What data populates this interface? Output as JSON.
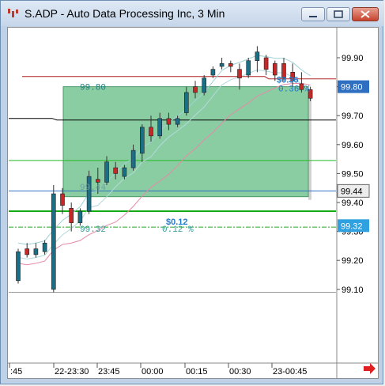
{
  "window": {
    "title": "S.ADP - Auto Data Processing Inc, 3 Min",
    "buttons": [
      "minimize",
      "restore",
      "close"
    ]
  },
  "chart_data": {
    "type": "candlestick",
    "symbol": "S.ADP",
    "interval": "3 Min",
    "ylim": [
      99.07,
      100.02
    ],
    "y_ticks": [
      "99.90",
      "99.80",
      "99.70",
      "99.60",
      "99.50",
      "99.40",
      "99.30",
      "99.20",
      "99.10"
    ],
    "x_ticks": [
      ":45",
      "22-23:30",
      "23:45",
      "00:00",
      "00:15",
      "00:30",
      "23-00:45"
    ],
    "price_markers": [
      {
        "label": "99.80",
        "value": 99.8,
        "fill": "#2f6fc2",
        "text": "#ffffff"
      },
      {
        "label": "99.44",
        "value": 99.44,
        "fill": "#ececec",
        "text": "#000000"
      },
      {
        "label": "99.32",
        "value": 99.32,
        "fill": "#2fa0e0",
        "text": "#ffffff"
      }
    ],
    "candles": [
      {
        "o": 99.13,
        "h": 99.24,
        "l": 99.12,
        "c": 99.23,
        "dir": "up"
      },
      {
        "o": 99.24,
        "h": 99.26,
        "l": 99.21,
        "c": 99.22,
        "dir": "down"
      },
      {
        "o": 99.22,
        "h": 99.26,
        "l": 99.21,
        "c": 99.24,
        "dir": "up"
      },
      {
        "o": 99.23,
        "h": 99.27,
        "l": 99.22,
        "c": 99.26,
        "dir": "up"
      },
      {
        "o": 99.1,
        "h": 99.46,
        "l": 99.09,
        "c": 99.43,
        "dir": "up"
      },
      {
        "o": 99.43,
        "h": 99.45,
        "l": 99.36,
        "c": 99.39,
        "dir": "down"
      },
      {
        "o": 99.38,
        "h": 99.4,
        "l": 99.3,
        "c": 99.33,
        "dir": "down"
      },
      {
        "o": 99.33,
        "h": 99.38,
        "l": 99.32,
        "c": 99.37,
        "dir": "up"
      },
      {
        "o": 99.37,
        "h": 99.51,
        "l": 99.36,
        "c": 99.49,
        "dir": "up"
      },
      {
        "o": 99.48,
        "h": 99.52,
        "l": 99.43,
        "c": 99.47,
        "dir": "down"
      },
      {
        "o": 99.47,
        "h": 99.56,
        "l": 99.46,
        "c": 99.54,
        "dir": "up"
      },
      {
        "o": 99.52,
        "h": 99.54,
        "l": 99.48,
        "c": 99.5,
        "dir": "down"
      },
      {
        "o": 99.49,
        "h": 99.53,
        "l": 99.48,
        "c": 99.52,
        "dir": "up"
      },
      {
        "o": 99.52,
        "h": 99.6,
        "l": 99.51,
        "c": 99.58,
        "dir": "up"
      },
      {
        "o": 99.57,
        "h": 99.67,
        "l": 99.54,
        "c": 99.66,
        "dir": "up"
      },
      {
        "o": 99.66,
        "h": 99.7,
        "l": 99.61,
        "c": 99.63,
        "dir": "down"
      },
      {
        "o": 99.63,
        "h": 99.71,
        "l": 99.62,
        "c": 99.69,
        "dir": "up"
      },
      {
        "o": 99.69,
        "h": 99.71,
        "l": 99.65,
        "c": 99.67,
        "dir": "down"
      },
      {
        "o": 99.67,
        "h": 99.7,
        "l": 99.66,
        "c": 99.69,
        "dir": "up"
      },
      {
        "o": 99.71,
        "h": 99.8,
        "l": 99.7,
        "c": 99.78,
        "dir": "up"
      },
      {
        "o": 99.8,
        "h": 99.82,
        "l": 99.76,
        "c": 99.78,
        "dir": "down"
      },
      {
        "o": 99.78,
        "h": 99.84,
        "l": 99.77,
        "c": 99.83,
        "dir": "up"
      },
      {
        "o": 99.84,
        "h": 99.87,
        "l": 99.83,
        "c": 99.86,
        "dir": "up"
      },
      {
        "o": 99.87,
        "h": 99.9,
        "l": 99.86,
        "c": 99.88,
        "dir": "up"
      },
      {
        "o": 99.88,
        "h": 99.89,
        "l": 99.85,
        "c": 99.87,
        "dir": "down"
      },
      {
        "o": 99.86,
        "h": 99.88,
        "l": 99.79,
        "c": 99.83,
        "dir": "down"
      },
      {
        "o": 99.84,
        "h": 99.9,
        "l": 99.83,
        "c": 99.89,
        "dir": "up"
      },
      {
        "o": 99.89,
        "h": 99.94,
        "l": 99.85,
        "c": 99.92,
        "dir": "up"
      },
      {
        "o": 99.9,
        "h": 99.91,
        "l": 99.84,
        "c": 99.86,
        "dir": "down"
      },
      {
        "o": 99.88,
        "h": 99.89,
        "l": 99.82,
        "c": 99.84,
        "dir": "down"
      },
      {
        "o": 99.88,
        "h": 99.9,
        "l": 99.82,
        "c": 99.83,
        "dir": "down"
      },
      {
        "o": 99.85,
        "h": 99.88,
        "l": 99.8,
        "c": 99.82,
        "dir": "down"
      },
      {
        "o": 99.81,
        "h": 99.85,
        "l": 99.78,
        "c": 99.79,
        "dir": "down"
      },
      {
        "o": 99.79,
        "h": 99.8,
        "l": 99.75,
        "c": 99.76,
        "dir": "down"
      }
    ],
    "horizontal_lines": [
      {
        "value": 99.835,
        "color": "#b22222"
      },
      {
        "value": 99.685,
        "color": "#000000"
      },
      {
        "value": 99.545,
        "color": "#22bb22"
      },
      {
        "value": 99.44,
        "color": "#2f6fc2"
      },
      {
        "value": 99.37,
        "color": "#11aa11"
      },
      {
        "value": 99.315,
        "color": "#22aa22",
        "dash": true
      },
      {
        "value": 99.09,
        "color": "#999999"
      }
    ],
    "position_box": {
      "top": 99.8,
      "bottom": 99.42,
      "fill": "#5ab87a"
    },
    "annotations": [
      {
        "text": "99.80",
        "value": 99.8,
        "color": "#1e7a7a"
      },
      {
        "text": "$0.36",
        "value": 99.825,
        "color": "#1e7acc"
      },
      {
        "text": "0.36 %",
        "value": 99.795,
        "color": "#1e7acc"
      },
      {
        "text": "99.32",
        "value": 99.31,
        "color": "#3a9a9a"
      },
      {
        "text": "$0.12",
        "value": 99.335,
        "color": "#1e7acc"
      },
      {
        "text": "0.12 %",
        "value": 99.31,
        "color": "#3a9a9a"
      },
      {
        "text": "99.44",
        "value": 99.455,
        "color": "#6aa0a0"
      }
    ]
  }
}
